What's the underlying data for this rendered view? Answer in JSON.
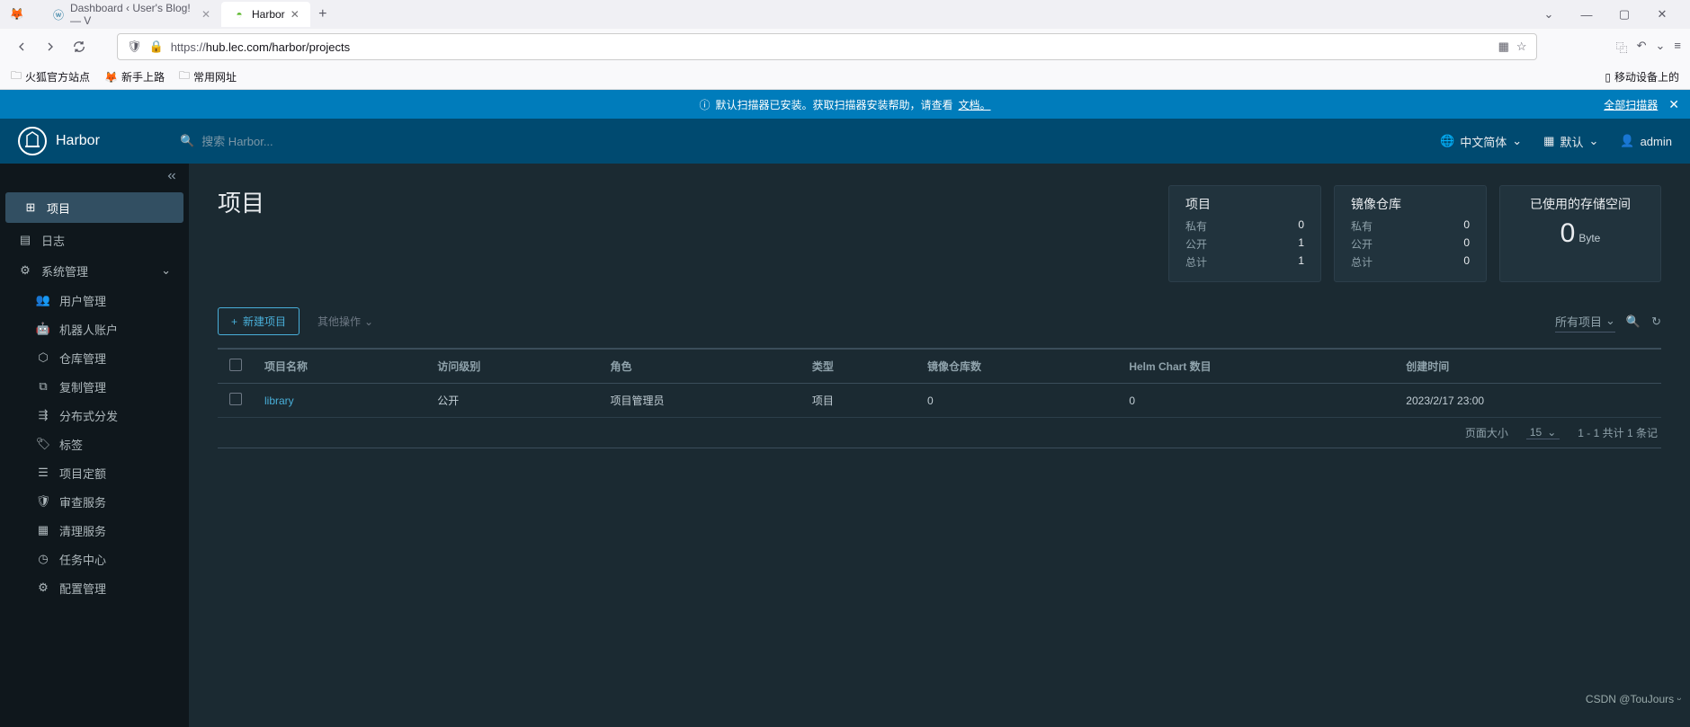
{
  "browser": {
    "tabs": [
      {
        "title": "Dashboard ‹ User's Blog! — V"
      },
      {
        "title": "Harbor"
      }
    ],
    "url": "https://hub.lec.com/harbor/projects",
    "url_prefix": "https://",
    "url_rest": "hub.lec.com/harbor/projects",
    "bookmarks": [
      {
        "label": "火狐官方站点",
        "icon": "folder"
      },
      {
        "label": "新手上路",
        "icon": "firefox"
      },
      {
        "label": "常用网址",
        "icon": "folder"
      }
    ],
    "bookmarks_right": "移动设备上的",
    "tab_add": "+"
  },
  "banner": {
    "text_before_link": "默认扫描器已安装。获取扫描器安装帮助，请查看 ",
    "link": "文档。",
    "right_label": "全部扫描器"
  },
  "harborHeader": {
    "appName": "Harbor",
    "searchPlaceholder": "搜索 Harbor...",
    "lang": "中文简体",
    "theme": "默认",
    "user": "admin"
  },
  "sidebar": {
    "items": [
      {
        "icon": "grid",
        "label": "项目",
        "active": true
      },
      {
        "icon": "doc",
        "label": "日志"
      },
      {
        "icon": "gear",
        "label": "系统管理",
        "group": true
      },
      {
        "icon": "users",
        "label": "用户管理",
        "indent": true
      },
      {
        "icon": "robot",
        "label": "机器人账户",
        "indent": true
      },
      {
        "icon": "cube",
        "label": "仓库管理",
        "indent": true
      },
      {
        "icon": "copy",
        "label": "复制管理",
        "indent": true
      },
      {
        "icon": "share",
        "label": "分布式分发",
        "indent": true
      },
      {
        "icon": "tag",
        "label": "标签",
        "indent": true
      },
      {
        "icon": "sliders",
        "label": "项目定额",
        "indent": true
      },
      {
        "icon": "shield",
        "label": "审查服务",
        "indent": true
      },
      {
        "icon": "trash",
        "label": "清理服务",
        "indent": true
      },
      {
        "icon": "task",
        "label": "任务中心",
        "indent": true
      },
      {
        "icon": "config",
        "label": "配置管理",
        "indent": true
      }
    ]
  },
  "page": {
    "title": "项目",
    "stats": {
      "projects": {
        "title": "项目",
        "rows": [
          [
            "私有",
            "0"
          ],
          [
            "公开",
            "1"
          ],
          [
            "总计",
            "1"
          ]
        ]
      },
      "repos": {
        "title": "镜像仓库",
        "rows": [
          [
            "私有",
            "0"
          ],
          [
            "公开",
            "0"
          ],
          [
            "总计",
            "0"
          ]
        ]
      },
      "storage": {
        "title": "已使用的存储空间",
        "value": "0",
        "unit": "Byte"
      }
    },
    "toolbar": {
      "newLabel": "新建项目",
      "otherOps": "其他操作",
      "filter": "所有项目"
    },
    "table": {
      "cols": [
        "项目名称",
        "访问级别",
        "角色",
        "类型",
        "镜像仓库数",
        "Helm Chart 数目",
        "创建时间"
      ],
      "rows": [
        {
          "name": "library",
          "access": "公开",
          "role": "项目管理员",
          "type": "项目",
          "repos": "0",
          "charts": "0",
          "created": "2023/2/17 23:00"
        }
      ]
    },
    "footer": {
      "pageSizeLabel": "页面大小",
      "pageSize": "15",
      "summary": "1 - 1 共计 1 条记"
    }
  },
  "watermark": "CSDN @TouJours ᵕ"
}
